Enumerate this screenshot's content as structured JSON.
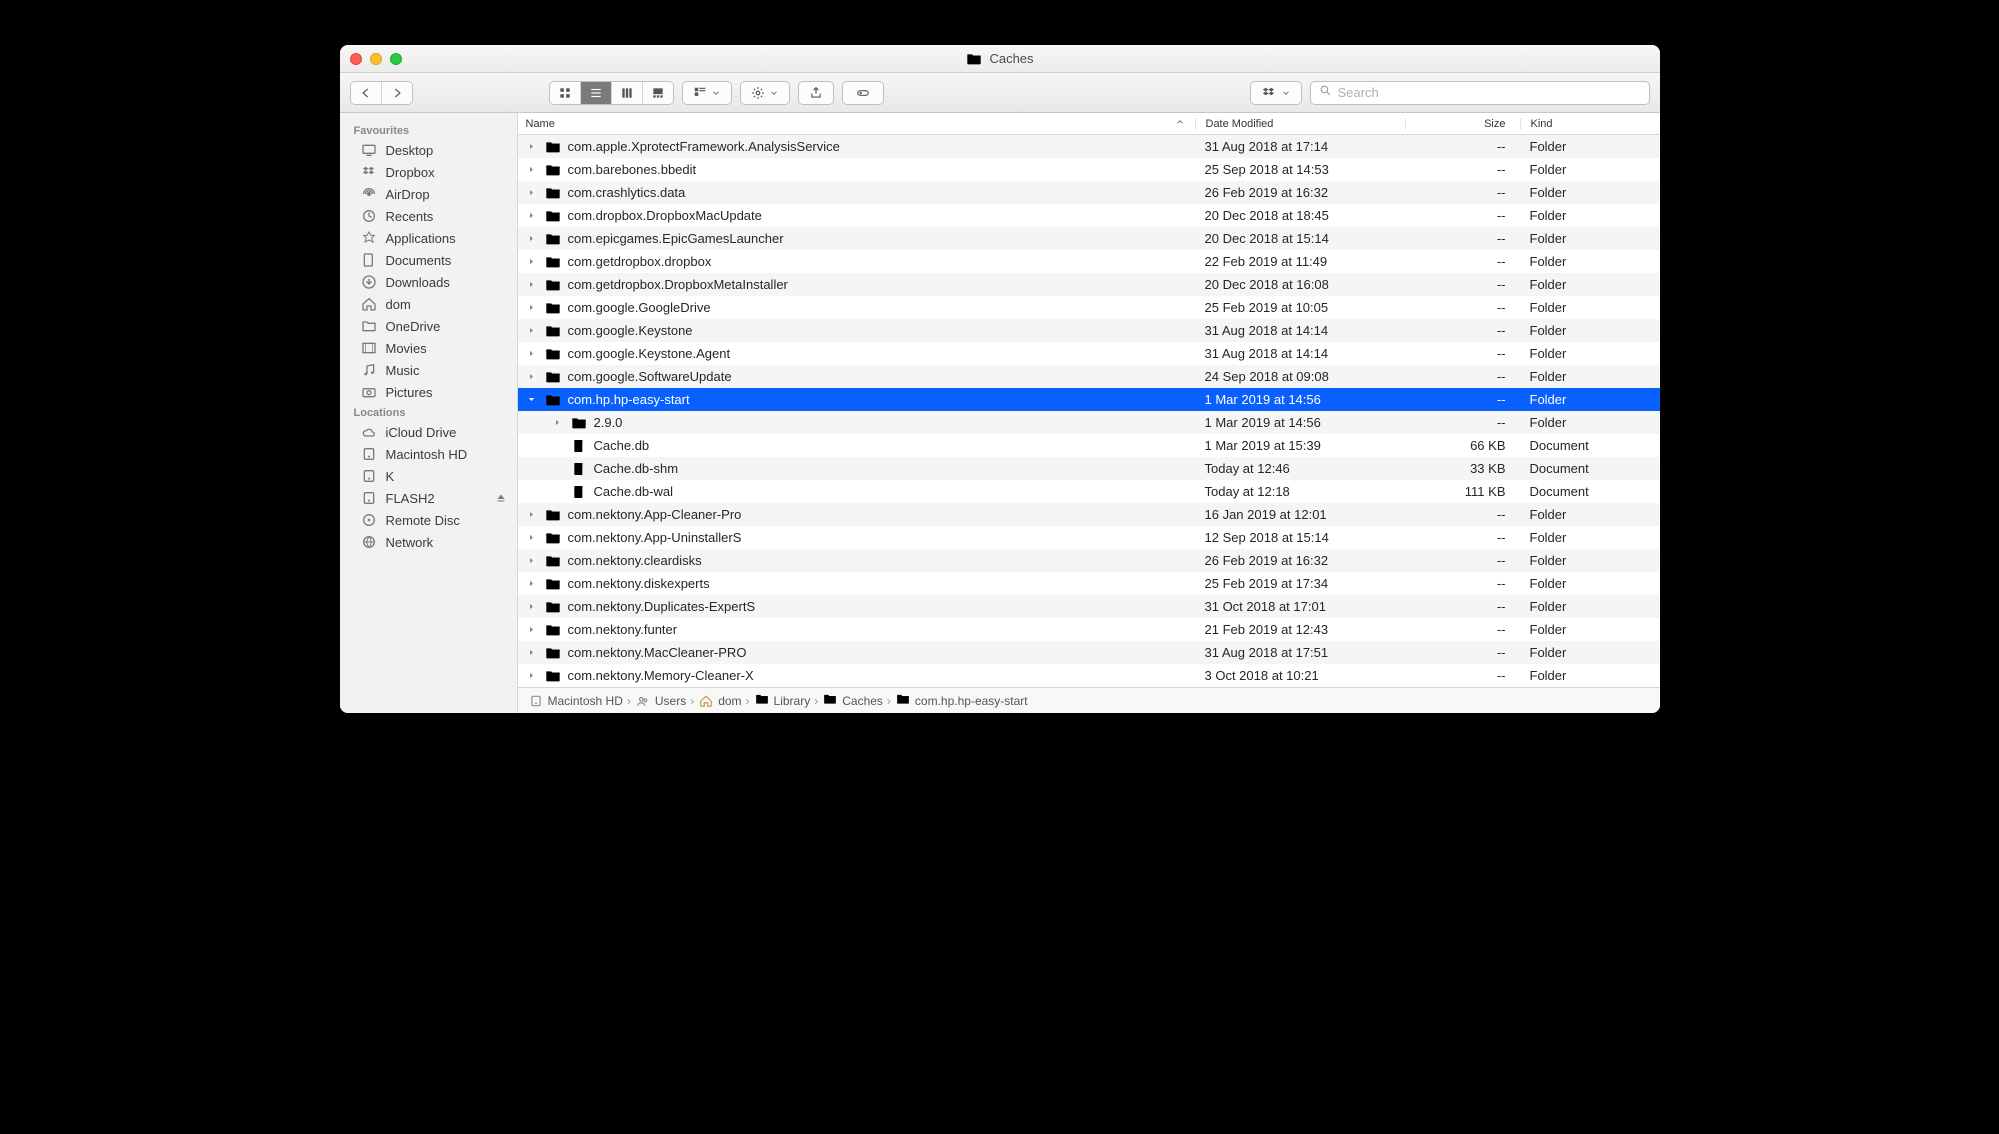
{
  "window_title": "Caches",
  "search_placeholder": "Search",
  "columns": {
    "name": "Name",
    "date": "Date Modified",
    "size": "Size",
    "kind": "Kind"
  },
  "sidebar": {
    "sections": [
      {
        "title": "Favourites",
        "items": [
          {
            "label": "Desktop",
            "icon": "desktop",
            "eject": false
          },
          {
            "label": "Dropbox",
            "icon": "dropbox",
            "eject": false
          },
          {
            "label": "AirDrop",
            "icon": "airdrop",
            "eject": false
          },
          {
            "label": "Recents",
            "icon": "clock",
            "eject": false
          },
          {
            "label": "Applications",
            "icon": "applications",
            "eject": false
          },
          {
            "label": "Documents",
            "icon": "documents",
            "eject": false
          },
          {
            "label": "Downloads",
            "icon": "downloads",
            "eject": false
          },
          {
            "label": "dom",
            "icon": "home",
            "eject": false
          },
          {
            "label": "OneDrive",
            "icon": "folder",
            "eject": false
          },
          {
            "label": "Movies",
            "icon": "movies",
            "eject": false
          },
          {
            "label": "Music",
            "icon": "music",
            "eject": false
          },
          {
            "label": "Pictures",
            "icon": "pictures",
            "eject": false
          }
        ]
      },
      {
        "title": "Locations",
        "items": [
          {
            "label": "iCloud Drive",
            "icon": "icloud",
            "eject": false
          },
          {
            "label": "Macintosh HD",
            "icon": "disk",
            "eject": false
          },
          {
            "label": "K",
            "icon": "disk",
            "eject": false
          },
          {
            "label": "FLASH2",
            "icon": "disk-ext",
            "eject": true
          },
          {
            "label": "Remote Disc",
            "icon": "optical",
            "eject": false
          },
          {
            "label": "Network",
            "icon": "network",
            "eject": false
          }
        ]
      }
    ]
  },
  "rows": [
    {
      "indent": 0,
      "disclosure": "right",
      "type": "folder",
      "name": "com.apple.XprotectFramework.AnalysisService",
      "date": "31 Aug 2018 at 17:14",
      "size": "--",
      "kind": "Folder",
      "selected": false
    },
    {
      "indent": 0,
      "disclosure": "right",
      "type": "folder",
      "name": "com.barebones.bbedit",
      "date": "25 Sep 2018 at 14:53",
      "size": "--",
      "kind": "Folder",
      "selected": false
    },
    {
      "indent": 0,
      "disclosure": "right",
      "type": "folder",
      "name": "com.crashlytics.data",
      "date": "26 Feb 2019 at 16:32",
      "size": "--",
      "kind": "Folder",
      "selected": false
    },
    {
      "indent": 0,
      "disclosure": "right",
      "type": "folder",
      "name": "com.dropbox.DropboxMacUpdate",
      "date": "20 Dec 2018 at 18:45",
      "size": "--",
      "kind": "Folder",
      "selected": false
    },
    {
      "indent": 0,
      "disclosure": "right",
      "type": "folder",
      "name": "com.epicgames.EpicGamesLauncher",
      "date": "20 Dec 2018 at 15:14",
      "size": "--",
      "kind": "Folder",
      "selected": false
    },
    {
      "indent": 0,
      "disclosure": "right",
      "type": "folder",
      "name": "com.getdropbox.dropbox",
      "date": "22 Feb 2019 at 11:49",
      "size": "--",
      "kind": "Folder",
      "selected": false
    },
    {
      "indent": 0,
      "disclosure": "right",
      "type": "folder",
      "name": "com.getdropbox.DropboxMetaInstaller",
      "date": "20 Dec 2018 at 16:08",
      "size": "--",
      "kind": "Folder",
      "selected": false
    },
    {
      "indent": 0,
      "disclosure": "right",
      "type": "folder",
      "name": "com.google.GoogleDrive",
      "date": "25 Feb 2019 at 10:05",
      "size": "--",
      "kind": "Folder",
      "selected": false
    },
    {
      "indent": 0,
      "disclosure": "right",
      "type": "folder",
      "name": "com.google.Keystone",
      "date": "31 Aug 2018 at 14:14",
      "size": "--",
      "kind": "Folder",
      "selected": false
    },
    {
      "indent": 0,
      "disclosure": "right",
      "type": "folder",
      "name": "com.google.Keystone.Agent",
      "date": "31 Aug 2018 at 14:14",
      "size": "--",
      "kind": "Folder",
      "selected": false
    },
    {
      "indent": 0,
      "disclosure": "right",
      "type": "folder",
      "name": "com.google.SoftwareUpdate",
      "date": "24 Sep 2018 at 09:08",
      "size": "--",
      "kind": "Folder",
      "selected": false
    },
    {
      "indent": 0,
      "disclosure": "down",
      "type": "folder",
      "name": "com.hp.hp-easy-start",
      "date": "1 Mar 2019 at 14:56",
      "size": "--",
      "kind": "Folder",
      "selected": true
    },
    {
      "indent": 1,
      "disclosure": "right",
      "type": "folder",
      "name": "2.9.0",
      "date": "1 Mar 2019 at 14:56",
      "size": "--",
      "kind": "Folder",
      "selected": false
    },
    {
      "indent": 1,
      "disclosure": "none",
      "type": "document",
      "name": "Cache.db",
      "date": "1 Mar 2019 at 15:39",
      "size": "66 KB",
      "kind": "Document",
      "selected": false
    },
    {
      "indent": 1,
      "disclosure": "none",
      "type": "document",
      "name": "Cache.db-shm",
      "date": "Today at 12:46",
      "size": "33 KB",
      "kind": "Document",
      "selected": false
    },
    {
      "indent": 1,
      "disclosure": "none",
      "type": "document",
      "name": "Cache.db-wal",
      "date": "Today at 12:18",
      "size": "111 KB",
      "kind": "Document",
      "selected": false
    },
    {
      "indent": 0,
      "disclosure": "right",
      "type": "folder",
      "name": "com.nektony.App-Cleaner-Pro",
      "date": "16 Jan 2019 at 12:01",
      "size": "--",
      "kind": "Folder",
      "selected": false
    },
    {
      "indent": 0,
      "disclosure": "right",
      "type": "folder",
      "name": "com.nektony.App-UninstallerS",
      "date": "12 Sep 2018 at 15:14",
      "size": "--",
      "kind": "Folder",
      "selected": false
    },
    {
      "indent": 0,
      "disclosure": "right",
      "type": "folder",
      "name": "com.nektony.cleardisks",
      "date": "26 Feb 2019 at 16:32",
      "size": "--",
      "kind": "Folder",
      "selected": false
    },
    {
      "indent": 0,
      "disclosure": "right",
      "type": "folder",
      "name": "com.nektony.diskexperts",
      "date": "25 Feb 2019 at 17:34",
      "size": "--",
      "kind": "Folder",
      "selected": false
    },
    {
      "indent": 0,
      "disclosure": "right",
      "type": "folder",
      "name": "com.nektony.Duplicates-ExpertS",
      "date": "31 Oct 2018 at 17:01",
      "size": "--",
      "kind": "Folder",
      "selected": false
    },
    {
      "indent": 0,
      "disclosure": "right",
      "type": "folder",
      "name": "com.nektony.funter",
      "date": "21 Feb 2019 at 12:43",
      "size": "--",
      "kind": "Folder",
      "selected": false
    },
    {
      "indent": 0,
      "disclosure": "right",
      "type": "folder",
      "name": "com.nektony.MacCleaner-PRO",
      "date": "31 Aug 2018 at 17:51",
      "size": "--",
      "kind": "Folder",
      "selected": false
    },
    {
      "indent": 0,
      "disclosure": "right",
      "type": "folder",
      "name": "com.nektony.Memory-Cleaner-X",
      "date": "3 Oct 2018 at 10:21",
      "size": "--",
      "kind": "Folder",
      "selected": false
    }
  ],
  "path": [
    {
      "label": "Macintosh HD",
      "icon": "disk"
    },
    {
      "label": "Users",
      "icon": "folder-users"
    },
    {
      "label": "dom",
      "icon": "home"
    },
    {
      "label": "Library",
      "icon": "folder"
    },
    {
      "label": "Caches",
      "icon": "folder"
    },
    {
      "label": "com.hp.hp-easy-start",
      "icon": "folder"
    }
  ]
}
